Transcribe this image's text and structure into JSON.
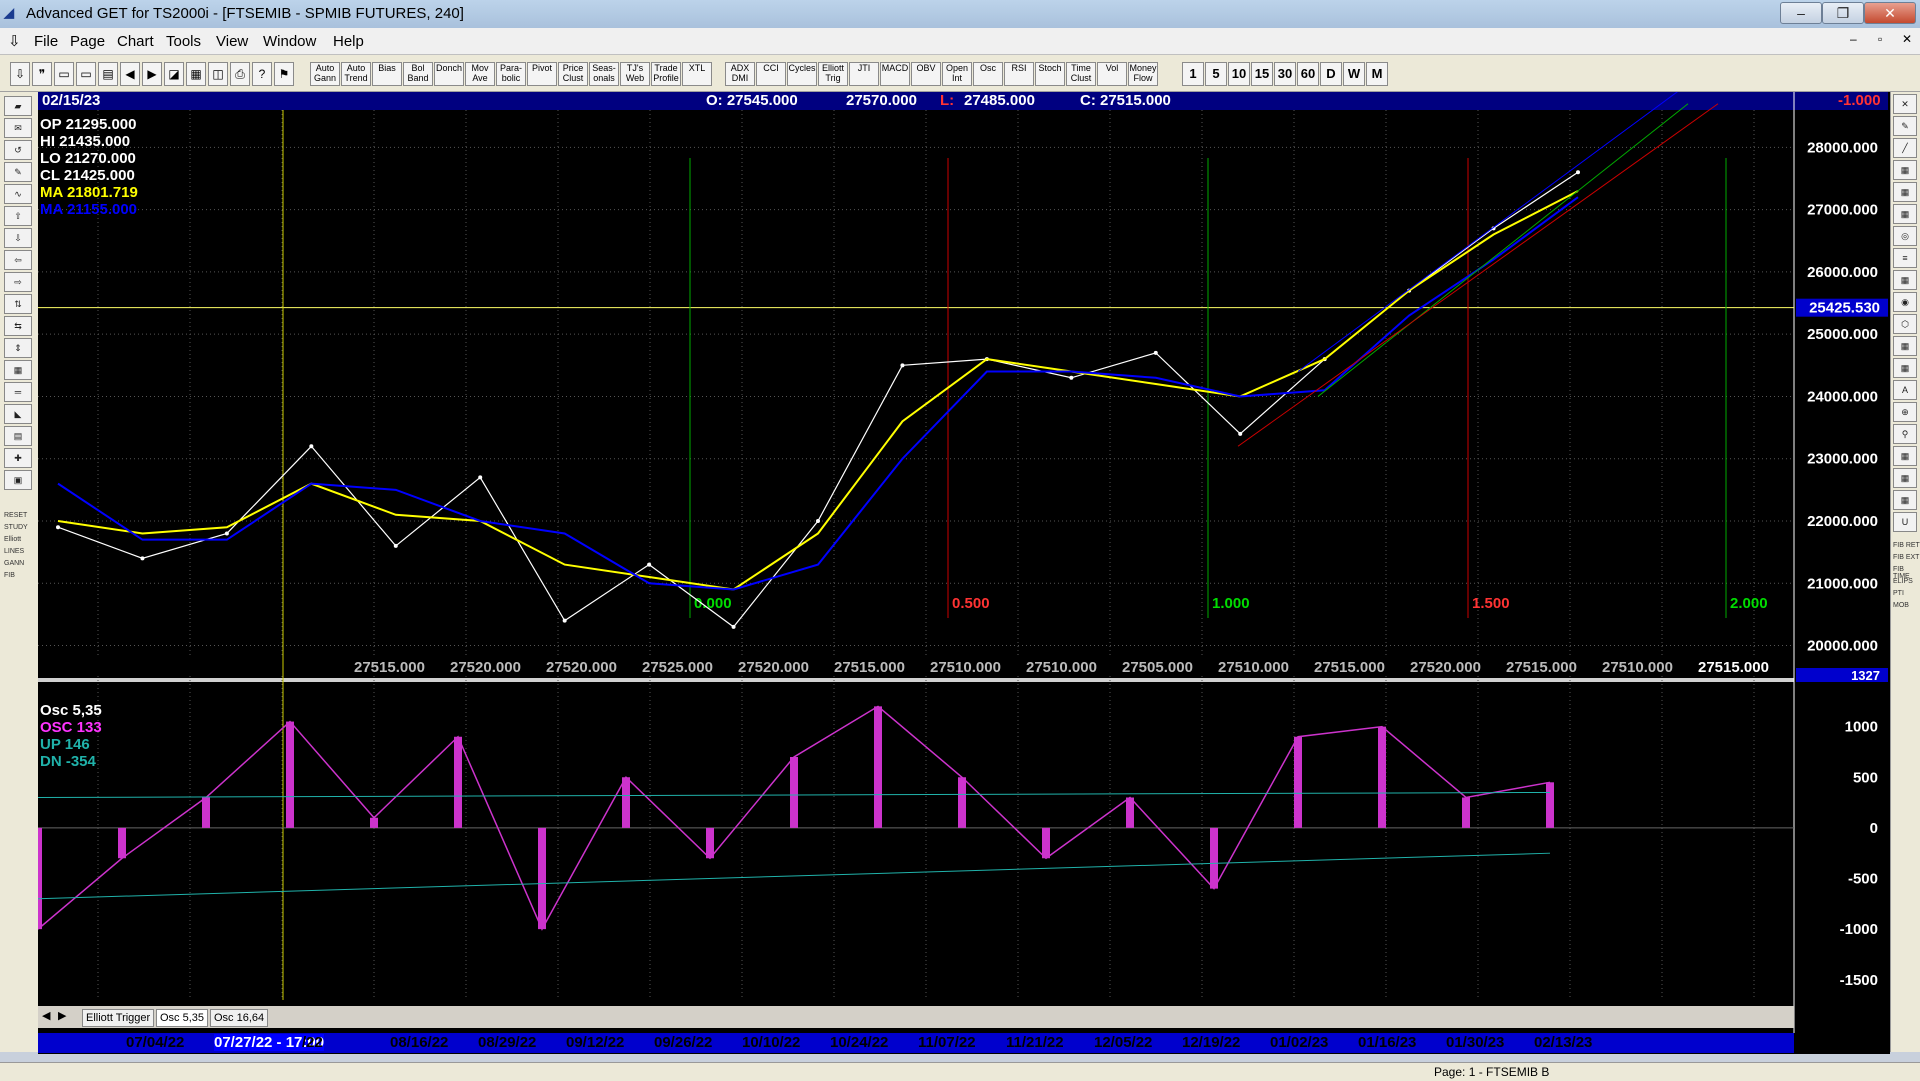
{
  "window": {
    "title": "Advanced GET for TS2000i - [FTSEMIB - SPMIB FUTURES, 240]",
    "btn_min": "‒",
    "btn_max": "❐",
    "btn_close": "✕",
    "mdi_min": "‒",
    "mdi_restore": "▫",
    "mdi_close": "✕"
  },
  "menu": [
    "File",
    "Page",
    "Chart",
    "Tools",
    "View",
    "Window",
    "Help"
  ],
  "toolbar": {
    "studies": [
      "Auto Gann",
      "Auto Trend",
      "Bias",
      "Bol Band",
      "Donch",
      "Mov Ave",
      "Para-bolic",
      "Pivot",
      "Price Clust",
      "Seas-onals",
      "TJ's Web",
      "Trade Profile",
      "XTL",
      "ADX DMI",
      "CCI",
      "Cycles",
      "Elliott Trig",
      "JTI",
      "MACD",
      "OBV",
      "Open Int",
      "Osc",
      "RSI",
      "Stoch",
      "Time Clust",
      "Vol",
      "Money Flow"
    ],
    "periods": [
      "1",
      "5",
      "10",
      "15",
      "30",
      "60",
      "D",
      "W",
      "M"
    ]
  },
  "left_tools": [
    "RESET",
    "STUDY",
    "Elliott",
    "LINES",
    "GANN",
    "FIB"
  ],
  "right_tools": [
    "FIB RET",
    "FIB EXT",
    "FIB TIME",
    "ELIPS",
    "PTI",
    "MOB"
  ],
  "header": {
    "date": "02/15/23",
    "open": "O: 27545.000",
    "high": "27570.000",
    "low_label": "L:",
    "low": "27485.000",
    "close": "C: 27515.000",
    "change": "-1.000"
  },
  "stats": {
    "op": "OP  21295.000",
    "hi": "HI   21435.000",
    "lo": "LO  21270.000",
    "cl": "CL  21425.000",
    "ma1": "MA  21801.719",
    "ma2": "MA  21155.000"
  },
  "price_axis": [
    "28000.000",
    "27000.000",
    "26000.000",
    "25000.000",
    "24000.000",
    "23000.000",
    "22000.000",
    "21000.000",
    "20000.000"
  ],
  "current_price": "25425.530",
  "bottom_prices": [
    "27515.000",
    "27520.000",
    "27520.000",
    "27525.000",
    "27520.000",
    "27515.000",
    "27510.000",
    "27510.000",
    "27505.000",
    "27510.000",
    "27515.000",
    "27520.000",
    "27515.000",
    "27510.000",
    "27515.000"
  ],
  "fib_time_labels": [
    "0.000",
    "0.500",
    "1.000",
    "1.500",
    "2.000"
  ],
  "osc": {
    "title": "Osc 5,35",
    "osc": "OSC 133",
    "up": "UP   146",
    "dn": "DN   -354",
    "axis": [
      "1000",
      "500",
      "0",
      "-500",
      "-1000",
      "-1500"
    ],
    "top_value": "1327"
  },
  "tabs": [
    "Elliott Trigger",
    "Osc 5,35",
    "Osc 16,64"
  ],
  "date_axis": [
    "07/04/22",
    "07/27/22 - 17:00",
    "/22",
    "08/16/22",
    "08/29/22",
    "09/12/22",
    "09/26/22",
    "10/10/22",
    "10/24/22",
    "11/07/22",
    "11/21/22",
    "12/05/22",
    "12/19/22",
    "01/02/23",
    "01/16/23",
    "01/30/23",
    "02/13/23"
  ],
  "status": "Page: 1 - FTSEMIB B",
  "colors": {
    "price": "#ffffff",
    "ma1": "#ffff00",
    "ma2": "#0000ff",
    "osc": "#cc33cc",
    "green": "#00cc00",
    "red": "#cc0000"
  },
  "chart_data": {
    "type": "line",
    "title": "FTSEMIB - SPMIB FUTURES, 240",
    "x": [
      "07/04/22",
      "07/18/22",
      "07/27/22",
      "08/16/22",
      "08/29/22",
      "09/12/22",
      "09/26/22",
      "10/03/22",
      "10/10/22",
      "10/24/22",
      "11/07/22",
      "11/21/22",
      "12/05/22",
      "12/12/22",
      "12/19/22",
      "01/02/23",
      "01/16/23",
      "01/30/23",
      "02/13/23"
    ],
    "series": [
      {
        "name": "Price",
        "values": [
          21900,
          21400,
          21800,
          23200,
          21600,
          22700,
          20400,
          21300,
          20300,
          22000,
          24500,
          24600,
          24300,
          24700,
          23400,
          24600,
          25700,
          26700,
          27600
        ]
      },
      {
        "name": "MA",
        "values": [
          22000,
          21800,
          21900,
          22600,
          22100,
          22000,
          21300,
          21100,
          20900,
          21800,
          23600,
          24600,
          24400,
          24200,
          24000,
          24600,
          25700,
          26600,
          27300
        ]
      },
      {
        "name": "MA",
        "values": [
          22600,
          21700,
          21700,
          22600,
          22500,
          22000,
          21800,
          21000,
          20900,
          21300,
          23000,
          24400,
          24400,
          24300,
          24000,
          24100,
          25300,
          26200,
          27200
        ]
      }
    ],
    "oscillator": {
      "name": "Osc 5,35",
      "values": [
        -1000,
        -300,
        300,
        1050,
        100,
        900,
        -1000,
        500,
        -300,
        700,
        1200,
        500,
        -300,
        300,
        -600,
        900,
        1000,
        300,
        450
      ]
    },
    "ylim": [
      19800,
      28600
    ],
    "grid": true
  }
}
